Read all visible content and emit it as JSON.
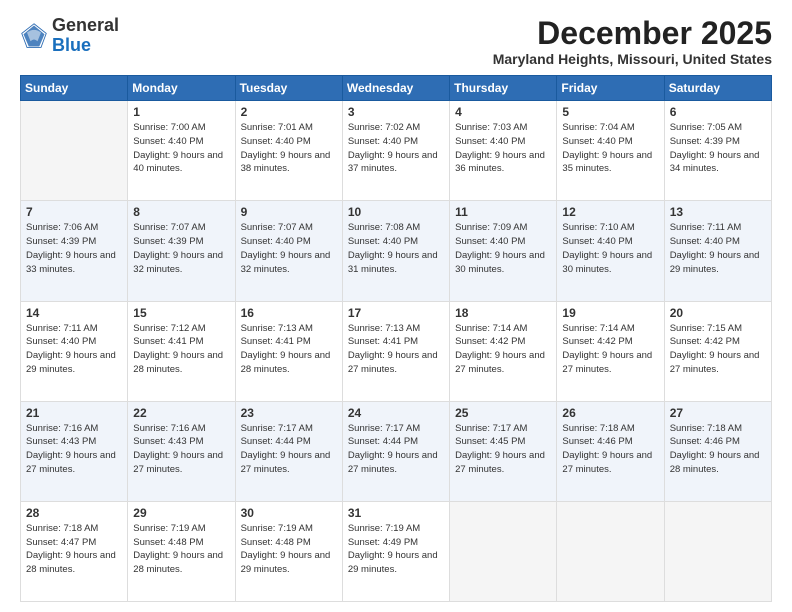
{
  "header": {
    "logo_general": "General",
    "logo_blue": "Blue",
    "month_title": "December 2025",
    "location": "Maryland Heights, Missouri, United States"
  },
  "days_of_week": [
    "Sunday",
    "Monday",
    "Tuesday",
    "Wednesday",
    "Thursday",
    "Friday",
    "Saturday"
  ],
  "weeks": [
    [
      {
        "day": "",
        "empty": true
      },
      {
        "day": "1",
        "sunrise": "Sunrise: 7:00 AM",
        "sunset": "Sunset: 4:40 PM",
        "daylight": "Daylight: 9 hours and 40 minutes."
      },
      {
        "day": "2",
        "sunrise": "Sunrise: 7:01 AM",
        "sunset": "Sunset: 4:40 PM",
        "daylight": "Daylight: 9 hours and 38 minutes."
      },
      {
        "day": "3",
        "sunrise": "Sunrise: 7:02 AM",
        "sunset": "Sunset: 4:40 PM",
        "daylight": "Daylight: 9 hours and 37 minutes."
      },
      {
        "day": "4",
        "sunrise": "Sunrise: 7:03 AM",
        "sunset": "Sunset: 4:40 PM",
        "daylight": "Daylight: 9 hours and 36 minutes."
      },
      {
        "day": "5",
        "sunrise": "Sunrise: 7:04 AM",
        "sunset": "Sunset: 4:40 PM",
        "daylight": "Daylight: 9 hours and 35 minutes."
      },
      {
        "day": "6",
        "sunrise": "Sunrise: 7:05 AM",
        "sunset": "Sunset: 4:39 PM",
        "daylight": "Daylight: 9 hours and 34 minutes."
      }
    ],
    [
      {
        "day": "7",
        "sunrise": "Sunrise: 7:06 AM",
        "sunset": "Sunset: 4:39 PM",
        "daylight": "Daylight: 9 hours and 33 minutes."
      },
      {
        "day": "8",
        "sunrise": "Sunrise: 7:07 AM",
        "sunset": "Sunset: 4:39 PM",
        "daylight": "Daylight: 9 hours and 32 minutes."
      },
      {
        "day": "9",
        "sunrise": "Sunrise: 7:07 AM",
        "sunset": "Sunset: 4:40 PM",
        "daylight": "Daylight: 9 hours and 32 minutes."
      },
      {
        "day": "10",
        "sunrise": "Sunrise: 7:08 AM",
        "sunset": "Sunset: 4:40 PM",
        "daylight": "Daylight: 9 hours and 31 minutes."
      },
      {
        "day": "11",
        "sunrise": "Sunrise: 7:09 AM",
        "sunset": "Sunset: 4:40 PM",
        "daylight": "Daylight: 9 hours and 30 minutes."
      },
      {
        "day": "12",
        "sunrise": "Sunrise: 7:10 AM",
        "sunset": "Sunset: 4:40 PM",
        "daylight": "Daylight: 9 hours and 30 minutes."
      },
      {
        "day": "13",
        "sunrise": "Sunrise: 7:11 AM",
        "sunset": "Sunset: 4:40 PM",
        "daylight": "Daylight: 9 hours and 29 minutes."
      }
    ],
    [
      {
        "day": "14",
        "sunrise": "Sunrise: 7:11 AM",
        "sunset": "Sunset: 4:40 PM",
        "daylight": "Daylight: 9 hours and 29 minutes."
      },
      {
        "day": "15",
        "sunrise": "Sunrise: 7:12 AM",
        "sunset": "Sunset: 4:41 PM",
        "daylight": "Daylight: 9 hours and 28 minutes."
      },
      {
        "day": "16",
        "sunrise": "Sunrise: 7:13 AM",
        "sunset": "Sunset: 4:41 PM",
        "daylight": "Daylight: 9 hours and 28 minutes."
      },
      {
        "day": "17",
        "sunrise": "Sunrise: 7:13 AM",
        "sunset": "Sunset: 4:41 PM",
        "daylight": "Daylight: 9 hours and 27 minutes."
      },
      {
        "day": "18",
        "sunrise": "Sunrise: 7:14 AM",
        "sunset": "Sunset: 4:42 PM",
        "daylight": "Daylight: 9 hours and 27 minutes."
      },
      {
        "day": "19",
        "sunrise": "Sunrise: 7:14 AM",
        "sunset": "Sunset: 4:42 PM",
        "daylight": "Daylight: 9 hours and 27 minutes."
      },
      {
        "day": "20",
        "sunrise": "Sunrise: 7:15 AM",
        "sunset": "Sunset: 4:42 PM",
        "daylight": "Daylight: 9 hours and 27 minutes."
      }
    ],
    [
      {
        "day": "21",
        "sunrise": "Sunrise: 7:16 AM",
        "sunset": "Sunset: 4:43 PM",
        "daylight": "Daylight: 9 hours and 27 minutes."
      },
      {
        "day": "22",
        "sunrise": "Sunrise: 7:16 AM",
        "sunset": "Sunset: 4:43 PM",
        "daylight": "Daylight: 9 hours and 27 minutes."
      },
      {
        "day": "23",
        "sunrise": "Sunrise: 7:17 AM",
        "sunset": "Sunset: 4:44 PM",
        "daylight": "Daylight: 9 hours and 27 minutes."
      },
      {
        "day": "24",
        "sunrise": "Sunrise: 7:17 AM",
        "sunset": "Sunset: 4:44 PM",
        "daylight": "Daylight: 9 hours and 27 minutes."
      },
      {
        "day": "25",
        "sunrise": "Sunrise: 7:17 AM",
        "sunset": "Sunset: 4:45 PM",
        "daylight": "Daylight: 9 hours and 27 minutes."
      },
      {
        "day": "26",
        "sunrise": "Sunrise: 7:18 AM",
        "sunset": "Sunset: 4:46 PM",
        "daylight": "Daylight: 9 hours and 27 minutes."
      },
      {
        "day": "27",
        "sunrise": "Sunrise: 7:18 AM",
        "sunset": "Sunset: 4:46 PM",
        "daylight": "Daylight: 9 hours and 28 minutes."
      }
    ],
    [
      {
        "day": "28",
        "sunrise": "Sunrise: 7:18 AM",
        "sunset": "Sunset: 4:47 PM",
        "daylight": "Daylight: 9 hours and 28 minutes."
      },
      {
        "day": "29",
        "sunrise": "Sunrise: 7:19 AM",
        "sunset": "Sunset: 4:48 PM",
        "daylight": "Daylight: 9 hours and 28 minutes."
      },
      {
        "day": "30",
        "sunrise": "Sunrise: 7:19 AM",
        "sunset": "Sunset: 4:48 PM",
        "daylight": "Daylight: 9 hours and 29 minutes."
      },
      {
        "day": "31",
        "sunrise": "Sunrise: 7:19 AM",
        "sunset": "Sunset: 4:49 PM",
        "daylight": "Daylight: 9 hours and 29 minutes."
      },
      {
        "day": "",
        "empty": true
      },
      {
        "day": "",
        "empty": true
      },
      {
        "day": "",
        "empty": true
      }
    ]
  ]
}
